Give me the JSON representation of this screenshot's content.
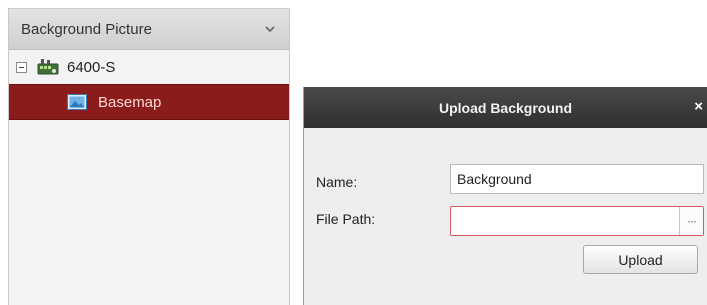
{
  "panel": {
    "title": "Background Picture",
    "tree": {
      "device": {
        "label": "6400-S"
      },
      "map": {
        "label": "Basemap",
        "selected": true
      }
    }
  },
  "dialog": {
    "title": "Upload Background",
    "close_label": "×",
    "name_label": "Name:",
    "name_value": "Background",
    "file_path_label": "File Path:",
    "file_path_value": "",
    "browse_label": "···",
    "upload_label": "Upload"
  },
  "colors": {
    "selection": "#8b1c1c",
    "titlebar": "#3a3a3a",
    "invalid_border": "#d45a5a"
  }
}
